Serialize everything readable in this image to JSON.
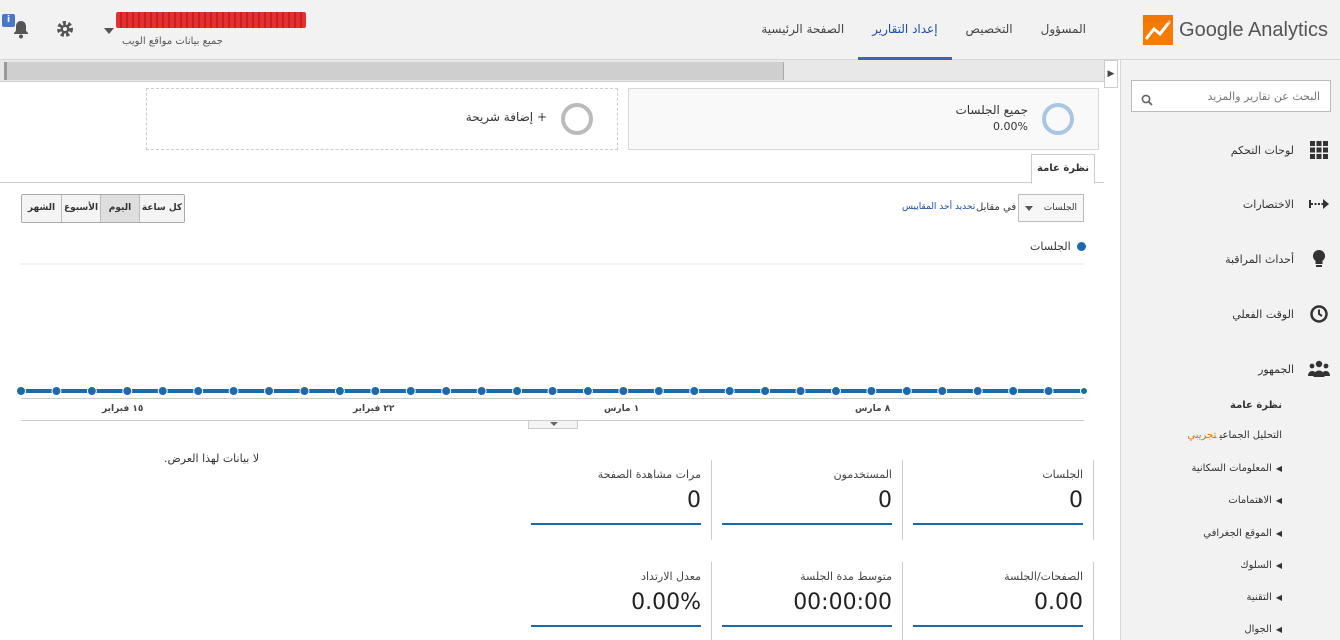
{
  "app": {
    "logo_text": "Google Analytics"
  },
  "topnav": [
    {
      "label": "الصفحة الرئيسية",
      "active": false
    },
    {
      "label": "إعداد التقارير",
      "active": true
    },
    {
      "label": "التخصيص",
      "active": false
    },
    {
      "label": "المسؤول",
      "active": false
    }
  ],
  "account": {
    "subtitle": "جميع بيانات مواقع الويب"
  },
  "sidebar": {
    "search_placeholder": "البحث عن تقارير والمزيد",
    "sections": [
      {
        "label": "لوحات التحكم",
        "icon": "grid-icon"
      },
      {
        "label": "الاختصارات",
        "icon": "shortcut-arrow-icon"
      },
      {
        "label": "أحداث المراقبة",
        "icon": "lightbulb-icon"
      },
      {
        "label": "الوقت الفعلي",
        "icon": "clock-icon"
      },
      {
        "label": "الجمهور",
        "icon": "people-icon"
      }
    ],
    "audience_items": [
      {
        "label": "نظرة عامة",
        "bold": true,
        "arrow": false
      },
      {
        "label": "التحليل الجماعي",
        "bold": false,
        "arrow": false,
        "beta": "تجريبي"
      },
      {
        "label": "المعلومات السكانية",
        "bold": false,
        "arrow": true
      },
      {
        "label": "الاهتمامات",
        "bold": false,
        "arrow": true
      },
      {
        "label": "الموقع الجغرافي",
        "bold": false,
        "arrow": true
      },
      {
        "label": "السلوك",
        "bold": false,
        "arrow": true
      },
      {
        "label": "التقنية",
        "bold": false,
        "arrow": true
      },
      {
        "label": "الجوال",
        "bold": false,
        "arrow": true
      }
    ]
  },
  "segments": {
    "all": {
      "title": "جميع الجلسات",
      "value": "0.00%"
    },
    "add": {
      "title": "+ إضافة شريحة"
    }
  },
  "tabs": {
    "overview": "نظرة عامة"
  },
  "controls": {
    "metric_select": "الجلسات",
    "vs_label": "في مقابل",
    "pick_metric": "تحديد أحد المقاييس",
    "time_buttons": [
      {
        "label": "كل ساعة",
        "selected": false
      },
      {
        "label": "اليوم",
        "selected": true
      },
      {
        "label": "الأسبوع",
        "selected": false
      },
      {
        "label": "الشهر",
        "selected": false
      }
    ]
  },
  "chart_data": {
    "type": "line",
    "series": [
      {
        "name": "الجلسات",
        "values": [
          0,
          0,
          0,
          0,
          0,
          0,
          0,
          0,
          0,
          0,
          0,
          0,
          0,
          0,
          0,
          0,
          0,
          0,
          0,
          0,
          0,
          0,
          0,
          0,
          0,
          0,
          0,
          0,
          0,
          0,
          0
        ]
      }
    ],
    "x_tick_labels": [
      "١٥ فبراير",
      "٢٢ فبراير",
      "١ مارس",
      "٨ مارس"
    ],
    "color": "#1c6aad"
  },
  "no_data_text": "لا بيانات لهذا العرض.",
  "stats": [
    {
      "label": "الجلسات",
      "value": "0"
    },
    {
      "label": "المستخدمون",
      "value": "0"
    },
    {
      "label": "مرات مشاهدة الصفحة",
      "value": "0"
    },
    {
      "label": "الصفحات/الجلسة",
      "value": "0.00"
    },
    {
      "label": "متوسط مدة الجلسة",
      "value": "00:00:00"
    },
    {
      "label": "معدل الارتداد",
      "value": "0.00%"
    }
  ]
}
